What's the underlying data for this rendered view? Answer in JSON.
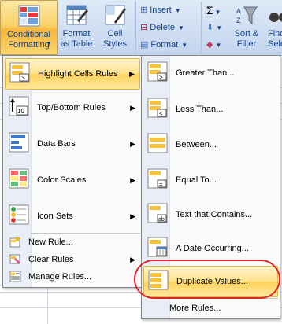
{
  "ribbon": {
    "conditional_formatting": "Conditional\nFormatting",
    "conditional_formatting_arrow": "▾",
    "format_as_table": "Format\nas Table",
    "format_as_table_arrow": "▾",
    "cell_styles": "Cell\nStyles",
    "cell_styles_arrow": "▾",
    "insert": "Insert",
    "delete": "Delete",
    "format": "Format",
    "sum_symbol": "Σ",
    "sort_filter": "Sort &\nFilter",
    "find": "Find\nSele"
  },
  "menu": {
    "items": [
      {
        "label": "Highlight Cells Rules",
        "icon": "highlight-cells-icon",
        "submenu": true
      },
      {
        "label": "Top/Bottom Rules",
        "icon": "top-bottom-icon",
        "submenu": true
      },
      {
        "label": "Data Bars",
        "icon": "data-bars-icon",
        "submenu": true
      },
      {
        "label": "Color Scales",
        "icon": "color-scales-icon",
        "submenu": true
      },
      {
        "label": "Icon Sets",
        "icon": "icon-sets-icon",
        "submenu": true
      }
    ],
    "small_items": [
      {
        "label": "New Rule...",
        "icon": "new-rule-icon"
      },
      {
        "label": "Clear Rules",
        "icon": "clear-rules-icon",
        "submenu": true
      },
      {
        "label": "Manage Rules...",
        "icon": "manage-rules-icon"
      }
    ],
    "arrow": "▶"
  },
  "submenu": {
    "items": [
      {
        "label": "Greater Than...",
        "icon": "greater-than-icon"
      },
      {
        "label": "Less Than...",
        "icon": "less-than-icon"
      },
      {
        "label": "Between...",
        "icon": "between-icon"
      },
      {
        "label": "Equal To...",
        "icon": "equal-to-icon"
      },
      {
        "label": "Text that Contains...",
        "icon": "text-contains-icon"
      },
      {
        "label": "A Date Occurring...",
        "icon": "date-occurring-icon"
      },
      {
        "label": "Duplicate Values...",
        "icon": "duplicate-values-icon"
      }
    ],
    "more_rules": "More Rules..."
  },
  "colors": {
    "highlight": "#ffd35a",
    "annotation": "#e0242a",
    "ribbon": "#d0def2"
  }
}
